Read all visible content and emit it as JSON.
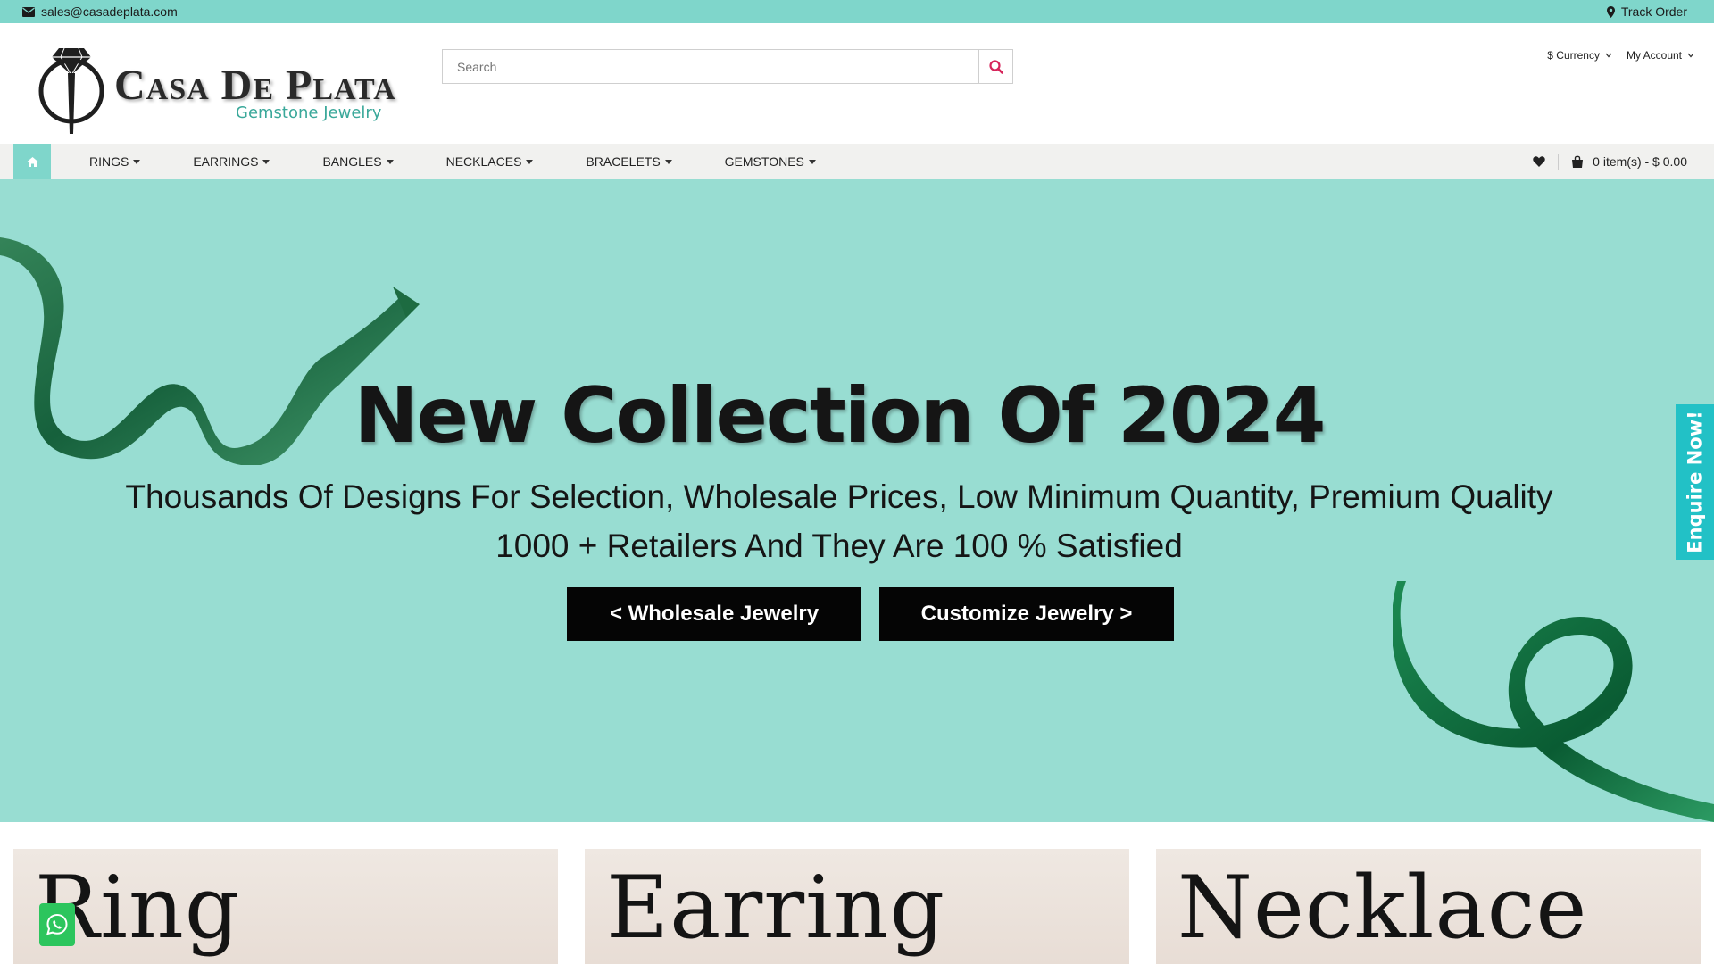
{
  "topbar": {
    "email": "sales@casadeplata.com",
    "track_order": "Track Order"
  },
  "brand": {
    "name": "Casa De Plata",
    "tagline": "Gemstone Jewelry"
  },
  "search": {
    "placeholder": "Search",
    "value": ""
  },
  "account": {
    "currency_label": "$ Currency",
    "account_label": "My Account"
  },
  "nav": {
    "items": [
      {
        "label": "RINGS"
      },
      {
        "label": "EARRINGS"
      },
      {
        "label": "BANGLES"
      },
      {
        "label": "NECKLACES"
      },
      {
        "label": "BRACELETS"
      },
      {
        "label": "GEMSTONES"
      }
    ],
    "cart_label": "0 item(s) - $ 0.00"
  },
  "hero": {
    "title": "New Collection Of 2024",
    "line1": "Thousands Of Designs For Selection, Wholesale Prices, Low Minimum Quantity, Premium Quality",
    "line2": "1000 + Retailers And They Are 100 % Satisfied",
    "btn_wholesale": "< Wholesale Jewelry",
    "btn_customize": "Customize Jewelry >"
  },
  "enquire": {
    "label": "Enquire Now!"
  },
  "categories": [
    {
      "label": "Ring"
    },
    {
      "label": "Earring"
    },
    {
      "label": "Necklace"
    }
  ],
  "colors": {
    "accent": "#7fd6cb",
    "hero_bg": "#98ddd2",
    "enquire": "#22c1c6",
    "search_icon": "#d6245a",
    "whatsapp": "#2cc55d"
  },
  "icons": {
    "email": "envelope-icon",
    "track": "map-pin-icon",
    "search": "search-icon",
    "home": "home-icon",
    "wishlist": "heart-icon",
    "cart": "shopping-bag-icon",
    "chat": "whatsapp-icon"
  }
}
